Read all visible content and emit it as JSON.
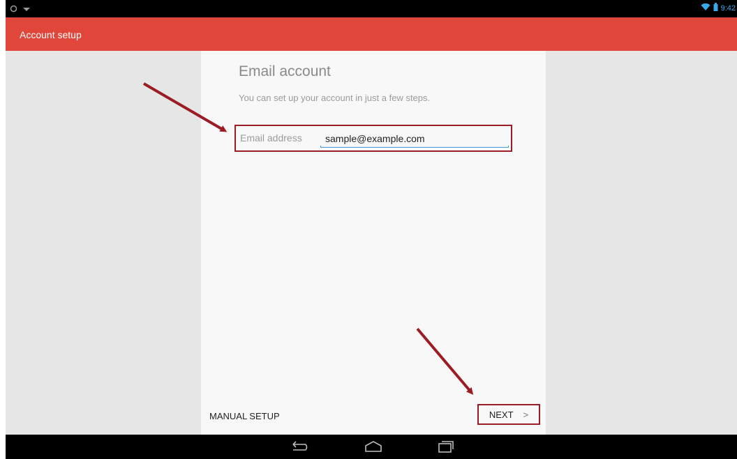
{
  "app": {
    "title": "Account setup"
  },
  "status": {
    "time": "9:42"
  },
  "form": {
    "heading": "Email account",
    "subheading": "You can set up your account in just a few steps.",
    "email_label": "Email address",
    "email_value": "sample@example.com"
  },
  "footer": {
    "manual_label": "MANUAL SETUP",
    "next_label": "NEXT"
  },
  "icons": {
    "status_left": [
      "circle-icon",
      "notification-icon"
    ],
    "status_right": [
      "wifi-icon",
      "battery-icon"
    ],
    "nav": [
      "back-icon",
      "home-icon",
      "recents-icon"
    ]
  },
  "colors": {
    "app_bar": "#e1463b",
    "annotation": "#9b1c24",
    "input_accent": "#3c9ad9"
  }
}
